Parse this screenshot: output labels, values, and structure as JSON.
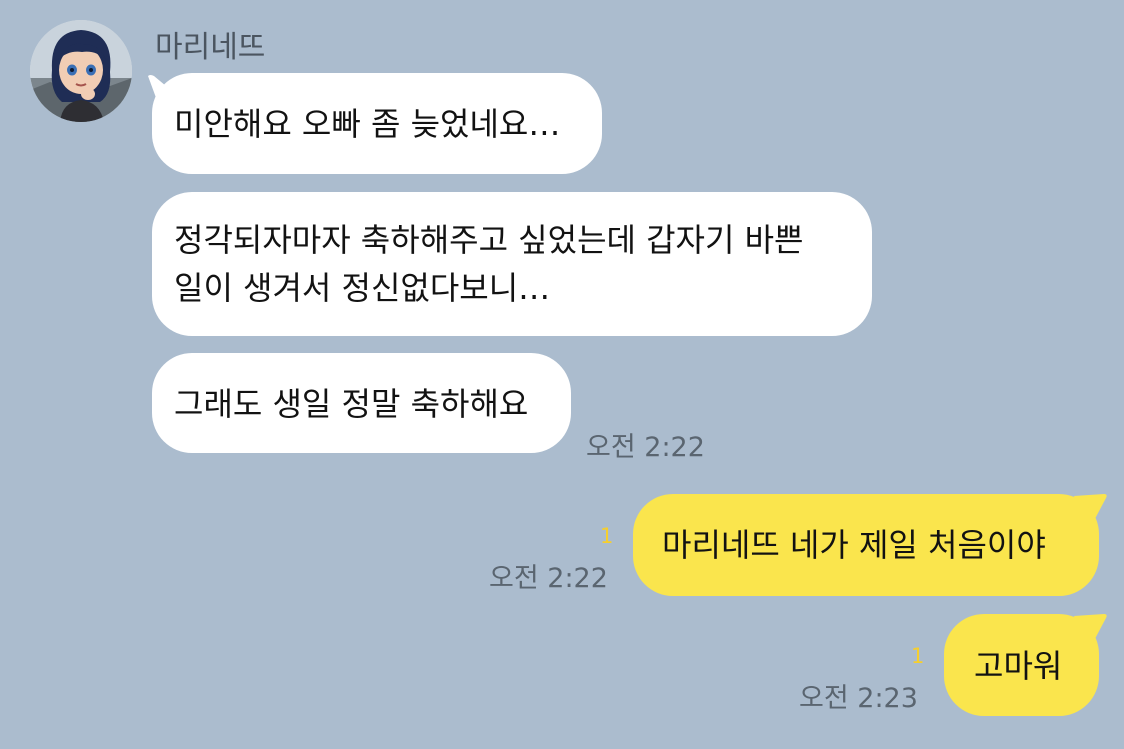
{
  "chat": {
    "sender_name": "마리네뜨",
    "messages": [
      {
        "direction": "incoming",
        "lines": [
          "미안해요 오빠 좀 늦었네요…"
        ]
      },
      {
        "direction": "incoming",
        "lines": [
          "정각되자마자 축하해주고 싶었는데 갑자기 바쁜",
          "일이 생겨서 정신없다보니…"
        ]
      },
      {
        "direction": "incoming",
        "lines": [
          "그래도 생일 정말 축하해요"
        ],
        "time": "오전 2:22"
      },
      {
        "direction": "outgoing",
        "lines": [
          "마리네뜨 네가 제일 처음이야"
        ],
        "time": "오전 2:22",
        "unread": "1"
      },
      {
        "direction": "outgoing",
        "lines": [
          "고마워"
        ],
        "time": "오전 2:23",
        "unread": "1"
      }
    ]
  },
  "colors": {
    "background": "#abbcce",
    "incoming_bubble": "#ffffff",
    "outgoing_bubble": "#fae54d",
    "unread_count": "#f6cf2e",
    "timestamp": "#5a6570"
  },
  "icons": {
    "avatar": "profile-photo"
  }
}
